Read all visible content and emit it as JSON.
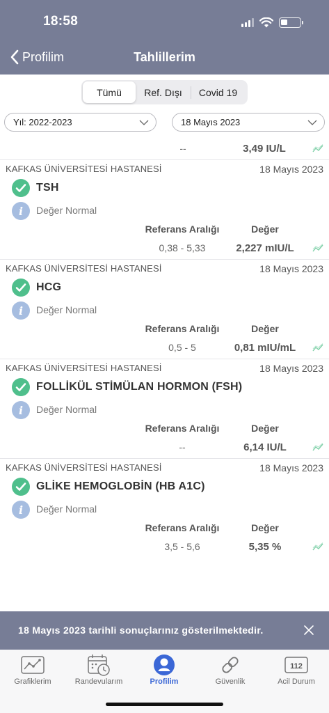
{
  "status_bar": {
    "time": "18:58"
  },
  "nav": {
    "back_label": "Profilim",
    "title": "Tahlillerim"
  },
  "segments": [
    "Tümü",
    "Ref. Dışı",
    "Covid 19"
  ],
  "active_segment": "Tümü",
  "filters": {
    "year": "Yıl: 2022-2023",
    "date": "18 Mayıs 2023"
  },
  "top_partial": {
    "ref": "--",
    "value": "3,49 IU/L"
  },
  "labels": {
    "ref_header": "Referans Aralığı",
    "value_header": "Değer"
  },
  "results": [
    {
      "hospital": "KAFKAS ÜNİVERSİTESİ HASTANESİ",
      "date": "18 Mayıs 2023",
      "test": "TSH",
      "status": "Değer Normal",
      "ref": "0,38 - 5,33",
      "value": "2,227 mIU/L"
    },
    {
      "hospital": "KAFKAS ÜNİVERSİTESİ HASTANESİ",
      "date": "18 Mayıs 2023",
      "test": "HCG",
      "status": "Değer Normal",
      "ref": "0,5 - 5",
      "value": "0,81 mIU/mL"
    },
    {
      "hospital": "KAFKAS ÜNİVERSİTESİ HASTANESİ",
      "date": "18 Mayıs 2023",
      "test": "FOLLİKÜL STİMÜLAN HORMON (FSH)",
      "status": "Değer Normal",
      "ref": "--",
      "value": "6,14 IU/L"
    },
    {
      "hospital": "KAFKAS ÜNİVERSİTESİ HASTANESİ",
      "date": "18 Mayıs 2023",
      "test": "GLİKE HEMOGLOBİN (HB A1C)",
      "status": "Değer Normal",
      "ref": "3,5 - 5,6",
      "value": "5,35 %"
    }
  ],
  "banner": {
    "text": "18 Mayıs 2023 tarihli sonuçlarınız gösterilmektedir."
  },
  "tabs": [
    {
      "label": "Grafiklerim",
      "icon": "chart-icon"
    },
    {
      "label": "Randevularım",
      "icon": "calendar-clock-icon"
    },
    {
      "label": "Profilim",
      "icon": "profile-icon",
      "active": true
    },
    {
      "label": "Güvenlik",
      "icon": "link-icon"
    },
    {
      "label": "Acil Durum",
      "icon": "emergency-112-icon",
      "badge": "112"
    }
  ],
  "colors": {
    "header": "#777d96",
    "check": "#4fbf8c",
    "info": "#a6bde0",
    "accent": "#3b67d6",
    "trend": "#7fd0a8"
  }
}
